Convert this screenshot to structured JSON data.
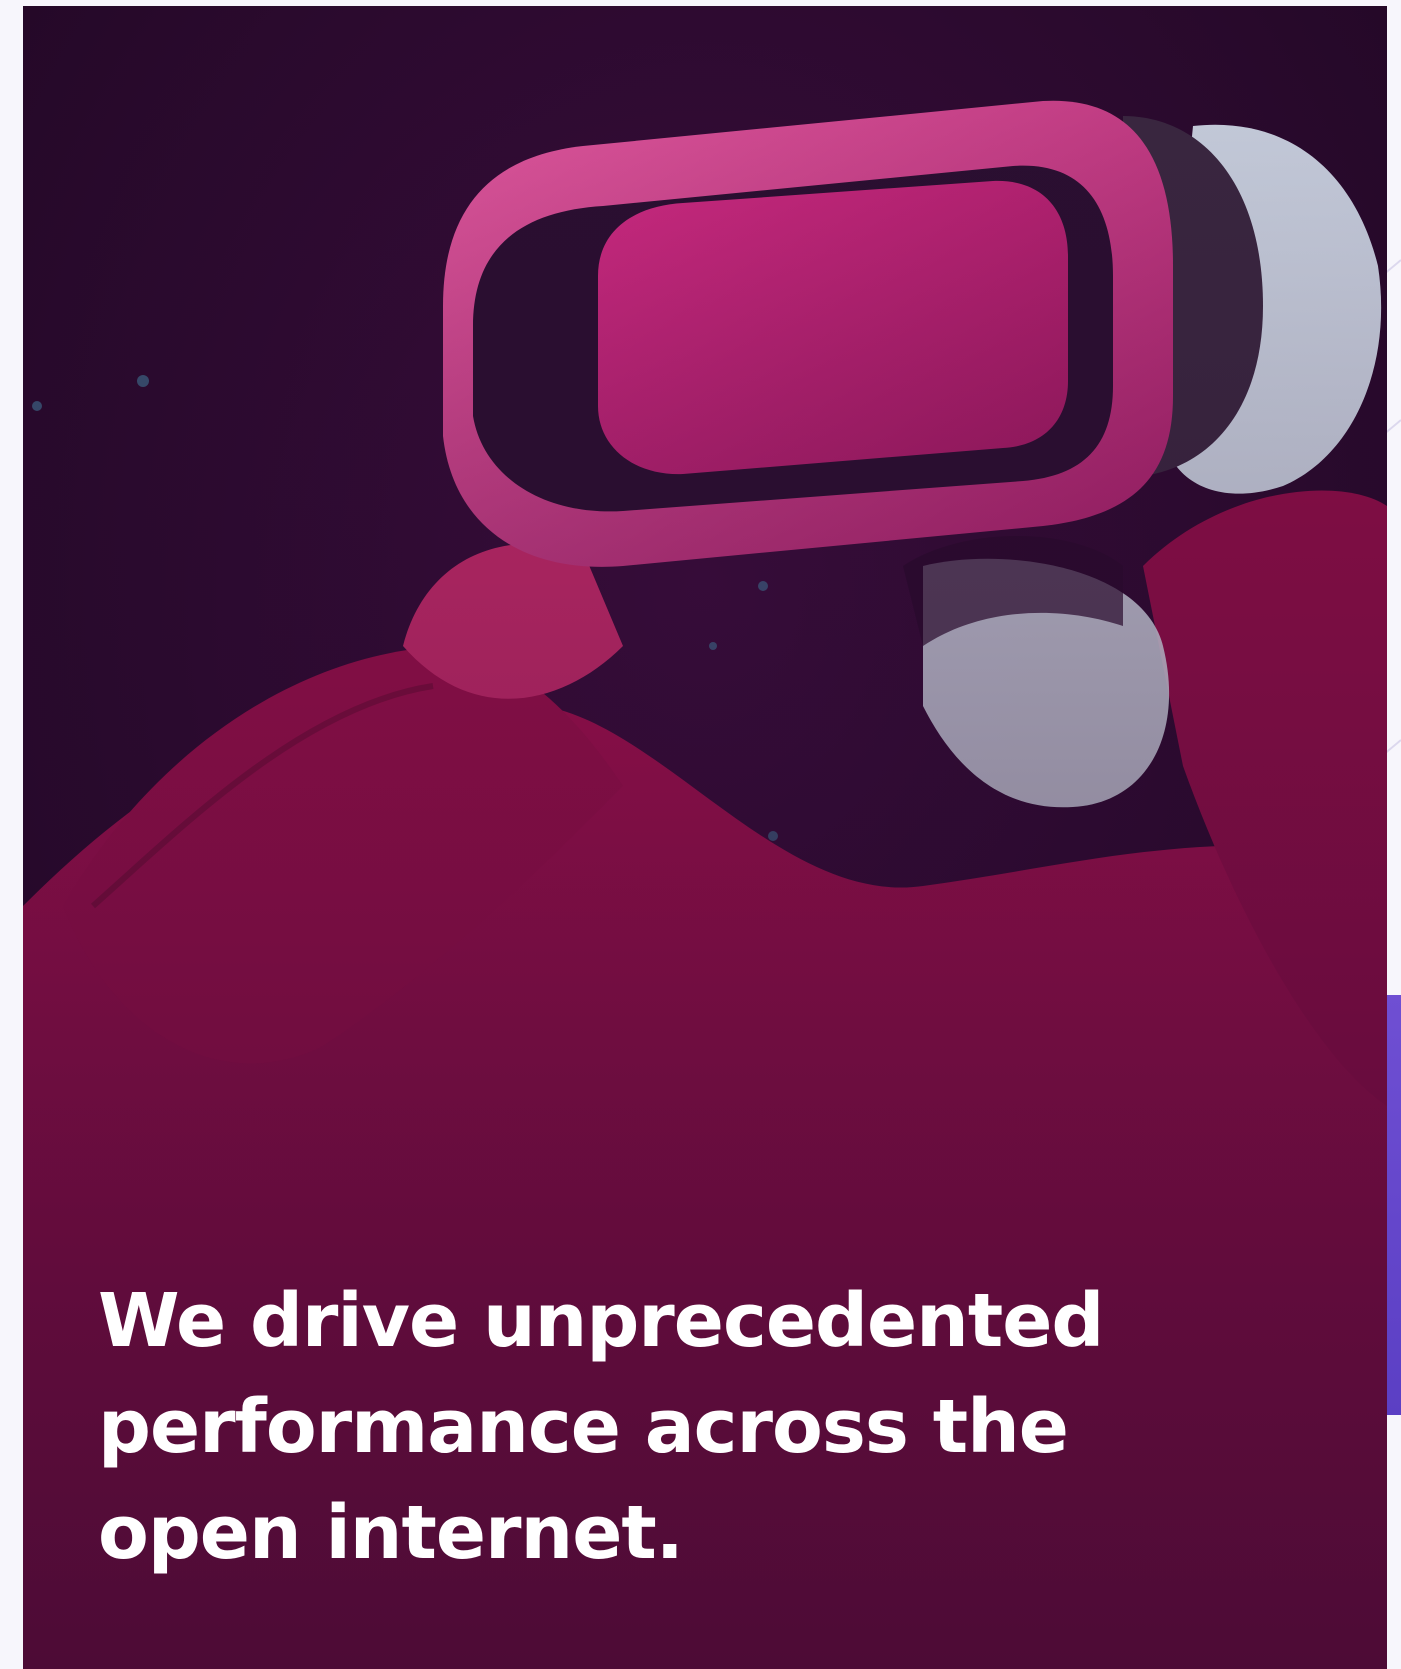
{
  "hero": {
    "headline": "We drive unprecedented performance across the open internet.",
    "image_subject": "person-wearing-vr-headset",
    "overlay_color": "#b0125f",
    "shadow_color": "#24092b"
  },
  "accent": {
    "color": "#6b4bd0"
  }
}
